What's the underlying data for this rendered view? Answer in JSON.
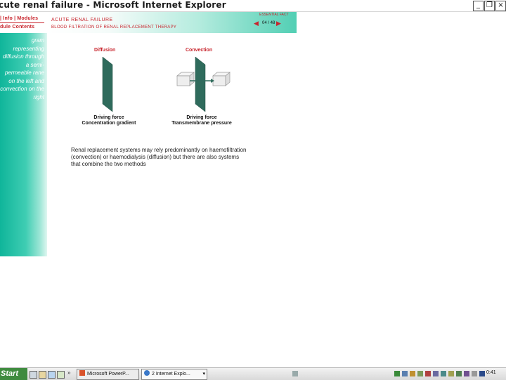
{
  "window": {
    "title": "cute renal failure - Microsoft Internet Explorer",
    "minimize": "_",
    "maximize": "❐",
    "close": "×"
  },
  "sidebar": {
    "nav1": "| Info | Modules",
    "nav2": "dule Contents",
    "description": "gram representing diffusion through a semi-permeable rane on the left and convection on the right"
  },
  "header": {
    "course": "Acute renal failure",
    "module": "Blood filtration of renal replacement therapy",
    "hint": "ESSENTIAL FACT",
    "prev": "◀",
    "next": "▶",
    "page": "04 / 48"
  },
  "diagram": {
    "diffusion_title": "Diffusion",
    "convection_title": "Convection",
    "diffusion_caption_1": "Driving force",
    "diffusion_caption_2": "Concentration gradient",
    "convection_caption_1": "Driving force",
    "convection_caption_2": "Transmembrane pressure",
    "membrane_color": "#2f6b5c"
  },
  "body_text": "Renal replacement systems may rely predominantly on haemofiltration (convection) or haemodialysis (diffusion) but there are also systems that combine the two methods",
  "taskbar": {
    "start": "Start",
    "chevron": "»",
    "task1": "Microsoft PowerP...",
    "task2": "2 Internet Explo...",
    "task2_arrow": "▾",
    "clock": "0:41"
  }
}
